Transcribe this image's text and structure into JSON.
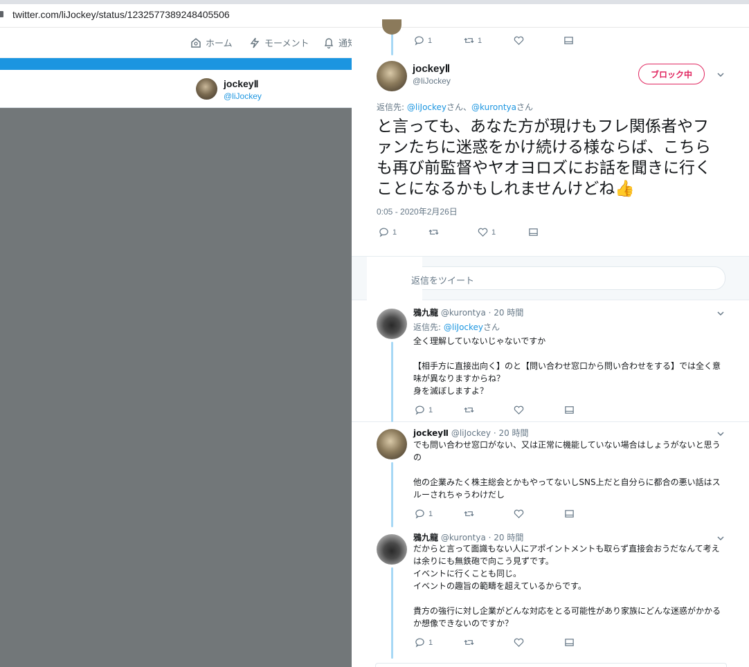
{
  "browser": {
    "url": "twitter.com/liJockey/status/1232577389248405506"
  },
  "nav": {
    "home": "ホーム",
    "moments": "モーメント",
    "notifications": "通知"
  },
  "profile": {
    "name": "jockeyⅡ",
    "handle": "@liJockey"
  },
  "main_tweet": {
    "prev_reply_count": "1",
    "prev_retweet_count": "1",
    "name": "jockeyⅡ",
    "handle": "@liJockey",
    "block_label": "ブロック中",
    "reply_to_prefix": "返信先:",
    "reply_to_user1": "@liJockey",
    "reply_to_san1": "さん、",
    "reply_to_user2": "@kurontya",
    "reply_to_san2": "さん",
    "text": "と言っても、あなた方が現けもフレ関係者やファンたちに迷惑をかけ続ける様ならば、こちらも再び前監督やヤオヨロズにお話を聞きに行くことになるかもしれませんけどね👍",
    "timestamp": "0:05 - 2020年2月26日",
    "reply_count": "1",
    "like_count": "1"
  },
  "reply_box": {
    "placeholder": "返信をツイート"
  },
  "replies": [
    {
      "name": "鴉九龍",
      "handle": "@kurontya",
      "time": "· 20 時間",
      "reply_to_prefix": "返信先:",
      "reply_to_user": "@liJockey",
      "reply_to_san": "さん",
      "text": "全く理解していないじゃないですか\n\n【相手方に直接出向く】のと【問い合わせ窓口から問い合わせをする】では全く意味が異なりますからね？\n身を滅ぼしますよ？",
      "reply_count": "1"
    },
    {
      "name": "jockeyⅡ",
      "handle": "@liJockey",
      "time": "· 20 時間",
      "text": "でも問い合わせ窓口がない、又は正常に機能していない場合はしょうがないと思うの\n\n他の企業みたく株主総会とかもやってないしSNS上だと自分らに都合の悪い話はスルーされちゃうわけだし",
      "reply_count": "1"
    },
    {
      "name": "鴉九龍",
      "handle": "@kurontya",
      "time": "· 20 時間",
      "text": "だからと言って面識もない人にアポイントメントも取らず直接会おうだなんて考えは余りにも無鉄砲で向こう見ずです。\nイベントに行くことも同じ。\nイベントの趣旨の範疇を超えているからです。\n\n貴方の強行に対し企業がどんな対応をとる可能性があり家族にどんな迷惑がかかるか想像できないのですか？",
      "reply_count": "1"
    }
  ],
  "colors": {
    "accent": "#1b95e0",
    "block": "#e0245e",
    "overlay": "#727779",
    "thread_line": "#a7d8f5"
  }
}
